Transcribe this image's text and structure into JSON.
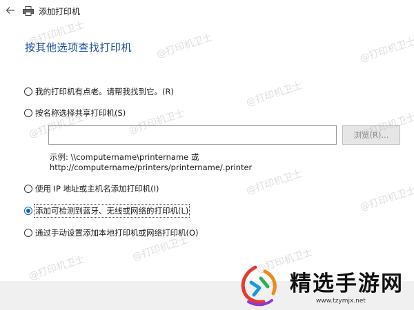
{
  "window": {
    "title": "添加打印机"
  },
  "heading": "按其他选项查找打印机",
  "options": [
    {
      "label": "我的打印机有点老。请帮我找到它。(R)",
      "checked": false
    },
    {
      "label": "按名称选择共享打印机(S)",
      "checked": false
    },
    {
      "label": "使用 IP 地址或主机名添加打印机(I)",
      "checked": false
    },
    {
      "label": "添加可检测到蓝牙、无线或网络的打印机(L)",
      "checked": true
    },
    {
      "label": "通过手动设置添加本地打印机或网络打印机(O)",
      "checked": false
    }
  ],
  "share": {
    "value": "",
    "browse_label": "浏览(R)...",
    "example_line1": "示例: \\\\computername\\printername 或",
    "example_line2": "http://computername/printers/printername/.printer"
  },
  "watermark_text": "@打印机卫士",
  "brand": {
    "name": "精选手游网",
    "url": "www.tzymjx.net"
  },
  "colors": {
    "heading": "#1a4fa0",
    "radio_selected": "#0a64c8",
    "footer": "#f0f0f0"
  }
}
